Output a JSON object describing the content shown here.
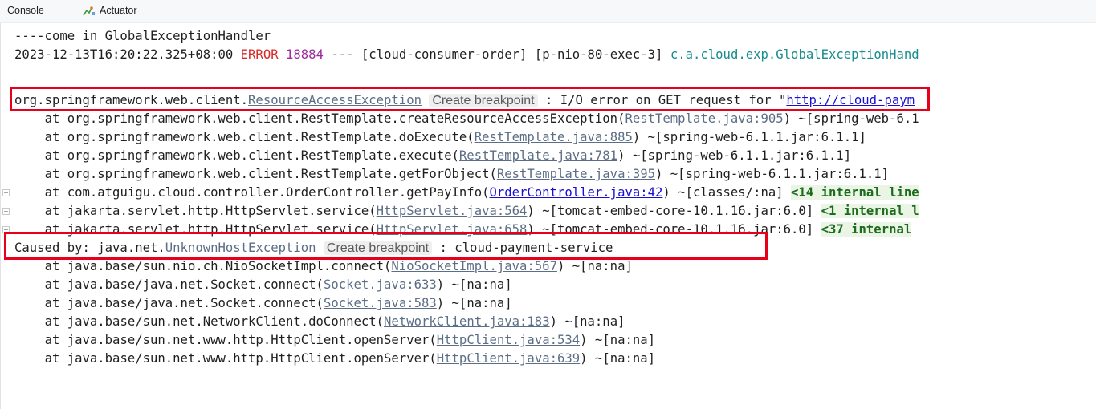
{
  "tabs": [
    {
      "label": "Console",
      "icon": "console"
    },
    {
      "label": "Actuator",
      "icon": "actuator-icon"
    }
  ],
  "log": {
    "header_line": "----come in GlobalExceptionHandler",
    "log_entry": {
      "timestamp": "2023-12-13T16:20:22.325+08:00",
      "level": "ERROR",
      "pid": "18884",
      "separator": "---",
      "app": "[cloud-consumer-order]",
      "thread": "[p-nio-80-exec-3]",
      "logger": "c.a.cloud.exp.GlobalExceptionHand"
    },
    "exception": {
      "prefix": "org.springframework.web.client.",
      "class_link": "ResourceAccessException",
      "hint": "Create breakpoint",
      "message": ": I/O error on GET request for ",
      "quote": "\"",
      "url": "http://cloud-paym"
    },
    "stack": [
      {
        "text": "at org.springframework.web.client.RestTemplate.createResourceAccessException(",
        "link": "RestTemplate.java:905",
        "after": ") ~[spring-web-6.1",
        "fold": ""
      },
      {
        "text": "at org.springframework.web.client.RestTemplate.doExecute(",
        "link": "RestTemplate.java:885",
        "after": ") ~[spring-web-6.1.1.jar:6.1.1]",
        "fold": ""
      },
      {
        "text": "at org.springframework.web.client.RestTemplate.execute(",
        "link": "RestTemplate.java:781",
        "after": ") ~[spring-web-6.1.1.jar:6.1.1]",
        "fold": ""
      },
      {
        "text": "at org.springframework.web.client.RestTemplate.getForObject(",
        "link": "RestTemplate.java:395",
        "after": ") ~[spring-web-6.1.1.jar:6.1.1]",
        "fold": ""
      },
      {
        "text": "at com.atguigu.cloud.controller.OrderController.getPayInfo(",
        "link": "OrderController.java:42",
        "after": ") ~[classes/:na] ",
        "fold": "<14 internal line"
      },
      {
        "text": "at jakarta.servlet.http.HttpServlet.service(",
        "link": "HttpServlet.java:564",
        "after": ") ~[tomcat-embed-core-10.1.16.jar:6.0] ",
        "fold": "<1 internal l"
      },
      {
        "text": "at jakarta.servlet.http.HttpServlet.service(",
        "link": "HttpServlet.java:658",
        "after": ") ~[tomcat-embed-core-10.1.16.jar:6.0] ",
        "fold": "<37 internal"
      }
    ],
    "caused_by": {
      "prefix": "Caused by: java.net.",
      "class_link": "UnknownHostException",
      "hint": "Create breakpoint",
      "message": ": cloud-payment-service"
    },
    "cause_stack": [
      {
        "text": "at java.base/sun.nio.ch.NioSocketImpl.connect(",
        "link": "NioSocketImpl.java:567",
        "after": ") ~[na:na]"
      },
      {
        "text": "at java.base/java.net.Socket.connect(",
        "link": "Socket.java:633",
        "after": ") ~[na:na]"
      },
      {
        "text": "at java.base/java.net.Socket.connect(",
        "link": "Socket.java:583",
        "after": ") ~[na:na]"
      },
      {
        "text": "at java.base/sun.net.NetworkClient.doConnect(",
        "link": "NetworkClient.java:183",
        "after": ") ~[na:na]"
      },
      {
        "text": "at java.base/sun.net.www.http.HttpClient.openServer(",
        "link": "HttpClient.java:534",
        "after": ") ~[na:na]"
      },
      {
        "text": "at java.base/sun.net.www.http.HttpClient.openServer(",
        "link": "HttpClient.java:639",
        "after": ") ~[na:na]"
      }
    ]
  },
  "colors": {
    "error": "#d62b2b",
    "link": "#5c6e86",
    "url": "#1a0ed4",
    "highlight_box": "#e8001b",
    "folded": "#1d6b1d"
  }
}
